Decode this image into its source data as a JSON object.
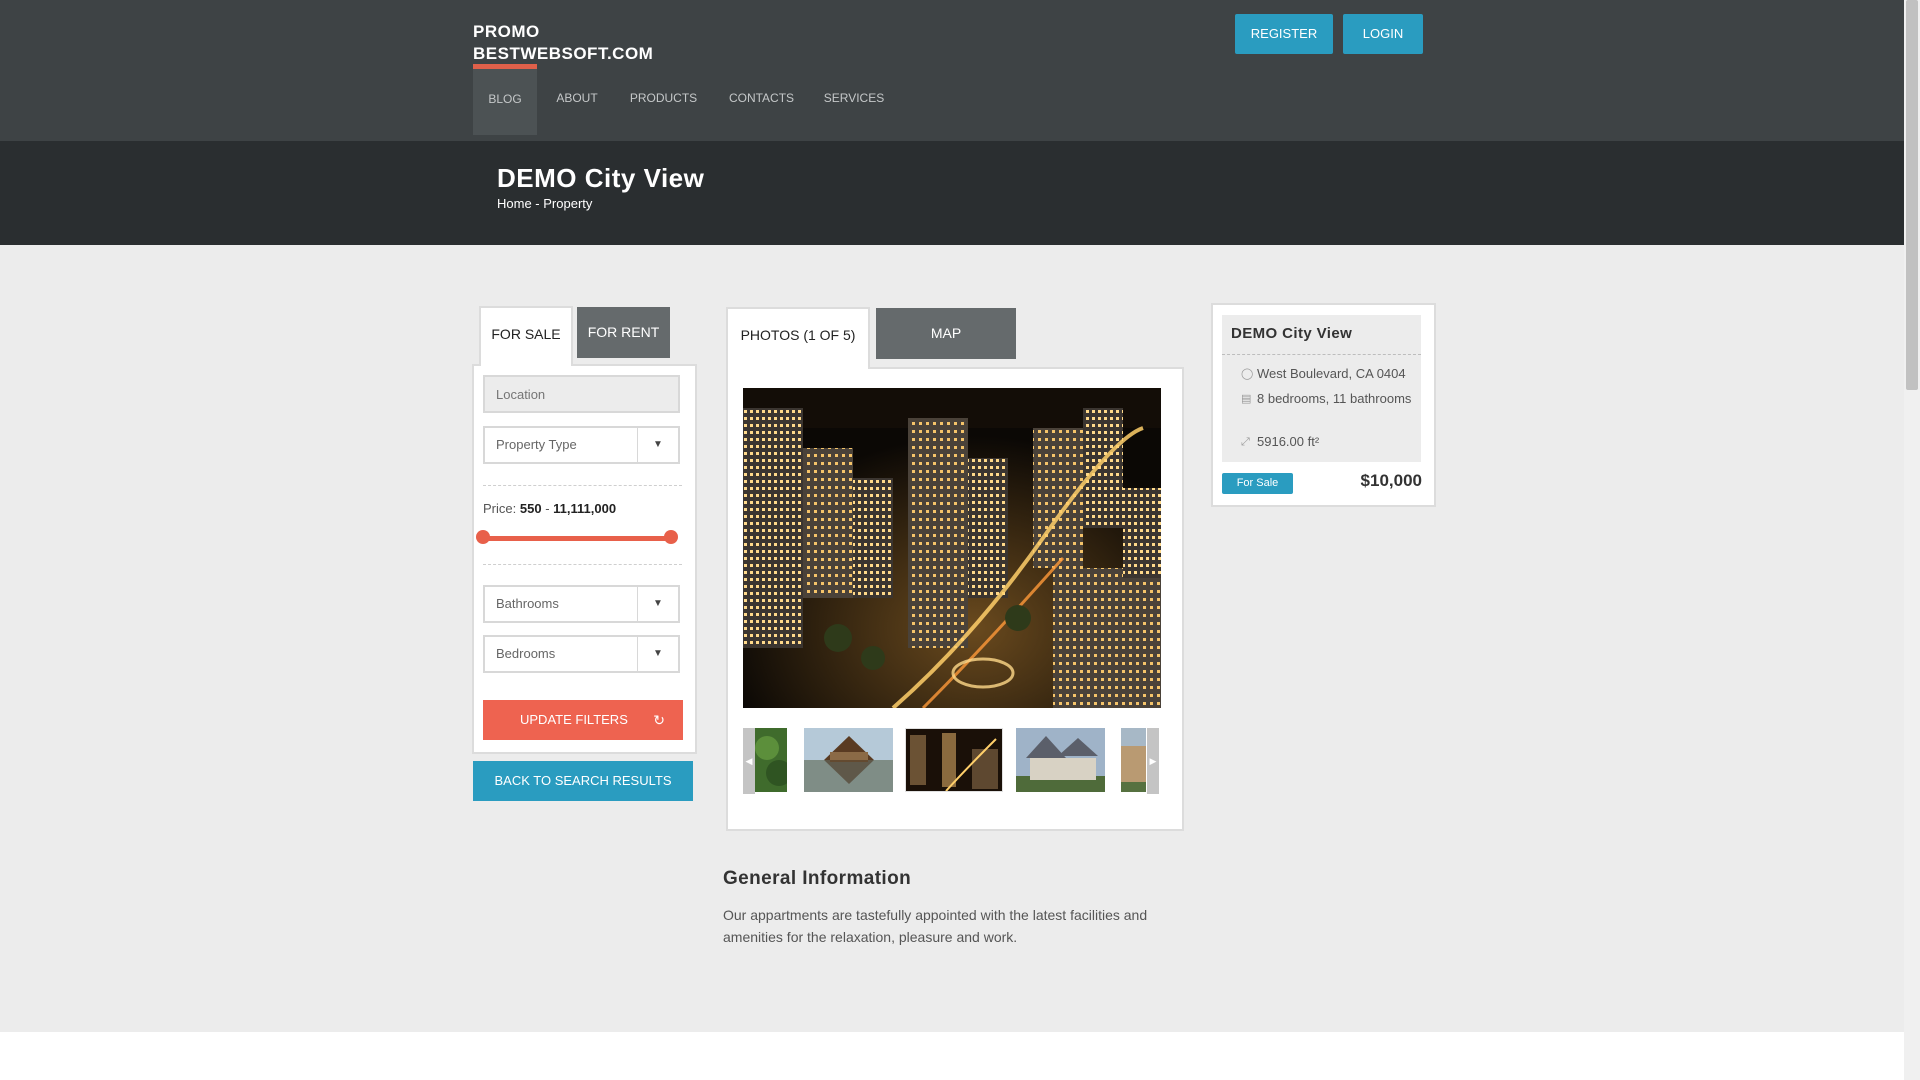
{
  "site": {
    "logo_line1": "PROMO",
    "logo_line2": "BESTWEBSOFT.COM",
    "register_label": "REGISTER",
    "login_label": "LOGIN"
  },
  "nav": {
    "items": [
      {
        "label": "BLOG",
        "active": true
      },
      {
        "label": "ABOUT"
      },
      {
        "label": "PRODUCTS"
      },
      {
        "label": "CONTACTS"
      },
      {
        "label": "SERVICES"
      }
    ]
  },
  "page": {
    "title": "DEMO City View",
    "breadcrumb_home": "Home",
    "breadcrumb_sep": " - ",
    "breadcrumb_current": "Property"
  },
  "search": {
    "tab_sale": "FOR SALE",
    "tab_rent": "FOR RENT",
    "location_placeholder": "Location",
    "property_type": "Property Type",
    "price_label": "Price:",
    "price_min": "550",
    "price_max": "11,111,000",
    "bathrooms": "Bathrooms",
    "bedrooms": "Bedrooms",
    "update_label": "UPDATE FILTERS",
    "back_label": "BACK TO SEARCH RESULTS"
  },
  "gallery": {
    "tab_photos": "PHOTOS (1 OF 5)",
    "tab_map": "MAP"
  },
  "info": {
    "title": "General Information",
    "text": "Our appartments are tastefully appointed with the latest facilities and amenities for the relaxation, pleasure and work."
  },
  "card": {
    "title": "DEMO City View",
    "address": "West Boulevard, CA 0404",
    "rooms": "8 bedrooms, 11 bathrooms",
    "area": "5916.00 ft²",
    "badge": "For Sale",
    "price": "$10,000"
  },
  "colors": {
    "accent_blue": "#2a9cc0",
    "accent_red": "#ee6350",
    "header_bg": "#3e4345",
    "title_band_bg": "#2a2e30"
  },
  "icons": {
    "select_arrow": "caret-down-icon",
    "refresh": "refresh-icon",
    "globe": "globe-icon",
    "bed": "bed-icon",
    "area": "resize-icon",
    "thumb_prev": "chevron-left-icon",
    "thumb_next": "chevron-right-icon"
  }
}
